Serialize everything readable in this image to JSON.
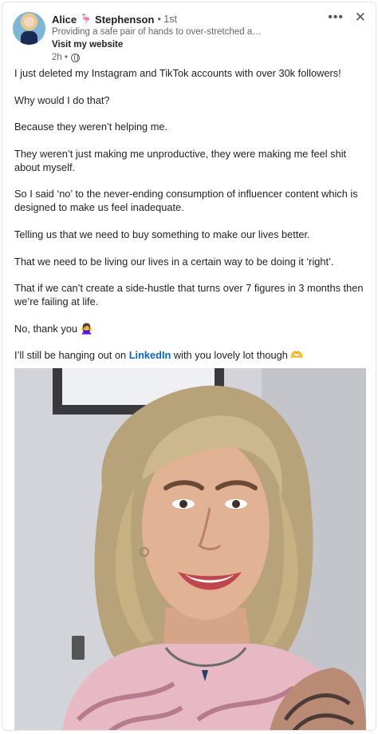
{
  "author": {
    "first_name": "Alice",
    "name_emoji": "🦩",
    "last_name": "Stephenson",
    "degree": "• 1st",
    "headline": "Providing a safe pair of hands to over-stretched a…",
    "website_label": "Visit my website",
    "time": "2h •"
  },
  "post": {
    "paragraphs": [
      "I just deleted my Instagram and TikTok accounts with over 30k followers!",
      "Why would I do that?",
      "Because they weren’t helping me.",
      "They weren’t just making me unproductive, they were making me feel shit about myself.",
      "So I said ‘no’ to the never-ending consumption of influencer content which is designed to make us feel inadequate.",
      "Telling us that we need to buy something to make our lives better.",
      "That we need to be living our lives in a certain way to be doing it ‘right’.",
      "That if we can’t create a side-hustle that turns over 7 figures in 3 months then we’re failing at life.",
      "No, thank you 🙅‍♀️"
    ],
    "last_before": "I’ll still be hanging out on ",
    "last_link": "LinkedIn",
    "last_after": " with you lovely lot though 🫶"
  },
  "controls": {
    "more": "•••",
    "close": "✕"
  }
}
